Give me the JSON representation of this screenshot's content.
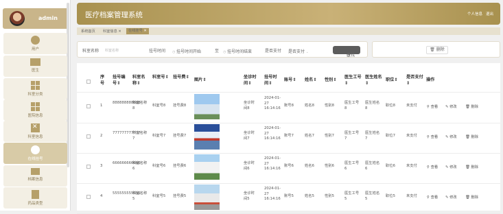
{
  "sidebar": {
    "user_name": "admin",
    "items": [
      {
        "label": "用户",
        "active": false
      },
      {
        "label": "医生",
        "active": false
      },
      {
        "label": "科室分类",
        "active": false
      },
      {
        "label": "医院信息",
        "active": false
      },
      {
        "label": "科室信息",
        "active": false
      },
      {
        "label": "在线挂号",
        "active": true
      },
      {
        "label": "档案信息",
        "active": false
      },
      {
        "label": "药品类型",
        "active": false
      }
    ]
  },
  "header": {
    "title": "医疗档案管理系统",
    "user_center": "个人信息",
    "logout": "退出"
  },
  "breadcrumb": {
    "home": "系统首页",
    "tab1": "科室信息",
    "tab2": "在线挂号"
  },
  "search": {
    "dept_label": "科室名称",
    "dept_placeholder": "科室名称",
    "time_label": "挂号时间",
    "time_start_placeholder": "挂号时间开始",
    "to": "至",
    "time_end_placeholder": "挂号时间结束",
    "paid_label": "是否支付",
    "paid_placeholder": "是否支付",
    "button": "查找"
  },
  "toolbar": {
    "delete": "删除"
  },
  "table": {
    "headers": [
      "序号",
      "挂号编号",
      "科室名称",
      "科室号",
      "挂号费",
      "图片",
      "坐诊时间",
      "挂号时间",
      "账号",
      "姓名",
      "性别",
      "医生工号",
      "医生姓名",
      "职位",
      "是否支付",
      "操作"
    ],
    "actions": {
      "view": "查看",
      "edit": "修改",
      "delete": "删除"
    },
    "rows": [
      {
        "index": "1",
        "reg_no": "888888888888",
        "dept_name": "科室名称8",
        "dept_no": "科室号8",
        "fee": "挂号费8",
        "consult_time": "坐诊时间8",
        "reg_time": "2024-01-27 16:14:16",
        "account": "账号8",
        "name": "姓名8",
        "gender": "性别8",
        "doc_id": "医生工号8",
        "doc_name": "医生姓名8",
        "position": "职位8",
        "paid": "未支付"
      },
      {
        "index": "2",
        "reg_no": "777777777777",
        "dept_name": "科室名称7",
        "dept_no": "科室号7",
        "fee": "挂号费7",
        "consult_time": "坐诊时间7",
        "reg_time": "2024-01-27 16:14:16",
        "account": "账号7",
        "name": "姓名7",
        "gender": "性别7",
        "doc_id": "医生工号7",
        "doc_name": "医生姓名7",
        "position": "职位7",
        "paid": "未支付"
      },
      {
        "index": "3",
        "reg_no": "666666666666",
        "dept_name": "科室名称6",
        "dept_no": "科室号6",
        "fee": "挂号费6",
        "consult_time": "坐诊时间6",
        "reg_time": "2024-01-27 16:14:16",
        "account": "账号6",
        "name": "姓名6",
        "gender": "性别6",
        "doc_id": "医生工号6",
        "doc_name": "医生姓名6",
        "position": "职位6",
        "paid": "未支付"
      },
      {
        "index": "4",
        "reg_no": "555555555555",
        "dept_name": "科室名称5",
        "dept_no": "科室号5",
        "fee": "挂号费5",
        "consult_time": "坐诊时间5",
        "reg_time": "2024-01-27 16:14:16",
        "account": "账号5",
        "name": "姓名5",
        "gender": "性别5",
        "doc_id": "医生工号5",
        "doc_name": "医生姓名5",
        "position": "职位5",
        "paid": "未支付"
      }
    ]
  }
}
